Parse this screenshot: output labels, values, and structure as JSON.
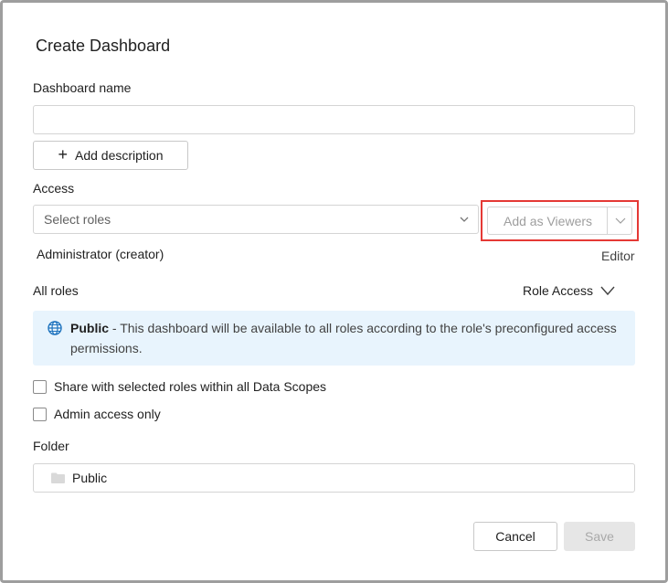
{
  "dialog": {
    "title": "Create Dashboard",
    "dashboard_name_label": "Dashboard name",
    "dashboard_name_value": "",
    "add_description_label": "Add description",
    "access_label": "Access",
    "select_roles_placeholder": "Select roles",
    "add_as_viewers_label": "Add as Viewers",
    "creator_name": "Administrator (creator)",
    "creator_role": "Editor",
    "all_roles_label": "All roles",
    "role_access_label": "Role Access",
    "info": {
      "bold": "Public",
      "text": " - This dashboard will be available to all roles according to the role's preconfigured access permissions."
    },
    "share_checkbox_label": "Share with selected roles within all Data Scopes",
    "admin_only_checkbox_label": "Admin access only",
    "folder_label": "Folder",
    "folder_value": "Public",
    "cancel_label": "Cancel",
    "save_label": "Save"
  },
  "colors": {
    "info_bg": "#e8f4fd",
    "globe": "#1e73be",
    "highlight": "#e53935",
    "save_disabled_bg": "#e6e6e6"
  },
  "icons": [
    "plus-icon",
    "chevron-down-icon",
    "globe-icon",
    "folder-icon"
  ]
}
